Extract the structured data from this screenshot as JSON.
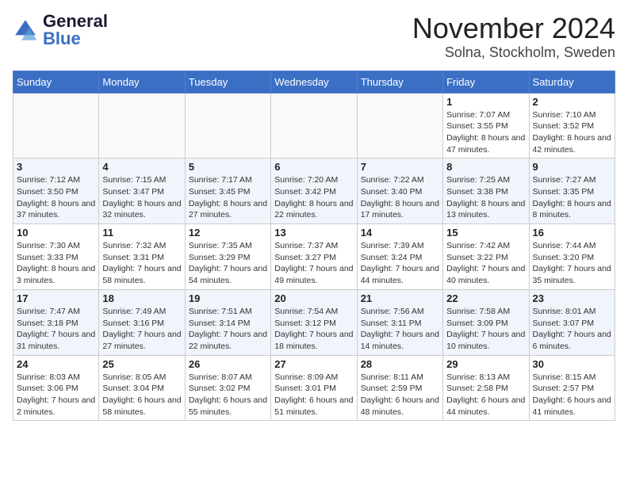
{
  "logo": {
    "text_general": "General",
    "text_blue": "Blue"
  },
  "title": "November 2024",
  "location": "Solna, Stockholm, Sweden",
  "days_of_week": [
    "Sunday",
    "Monday",
    "Tuesday",
    "Wednesday",
    "Thursday",
    "Friday",
    "Saturday"
  ],
  "weeks": [
    [
      {
        "day": "",
        "detail": ""
      },
      {
        "day": "",
        "detail": ""
      },
      {
        "day": "",
        "detail": ""
      },
      {
        "day": "",
        "detail": ""
      },
      {
        "day": "",
        "detail": ""
      },
      {
        "day": "1",
        "detail": "Sunrise: 7:07 AM\nSunset: 3:55 PM\nDaylight: 8 hours and 47 minutes."
      },
      {
        "day": "2",
        "detail": "Sunrise: 7:10 AM\nSunset: 3:52 PM\nDaylight: 8 hours and 42 minutes."
      }
    ],
    [
      {
        "day": "3",
        "detail": "Sunrise: 7:12 AM\nSunset: 3:50 PM\nDaylight: 8 hours and 37 minutes."
      },
      {
        "day": "4",
        "detail": "Sunrise: 7:15 AM\nSunset: 3:47 PM\nDaylight: 8 hours and 32 minutes."
      },
      {
        "day": "5",
        "detail": "Sunrise: 7:17 AM\nSunset: 3:45 PM\nDaylight: 8 hours and 27 minutes."
      },
      {
        "day": "6",
        "detail": "Sunrise: 7:20 AM\nSunset: 3:42 PM\nDaylight: 8 hours and 22 minutes."
      },
      {
        "day": "7",
        "detail": "Sunrise: 7:22 AM\nSunset: 3:40 PM\nDaylight: 8 hours and 17 minutes."
      },
      {
        "day": "8",
        "detail": "Sunrise: 7:25 AM\nSunset: 3:38 PM\nDaylight: 8 hours and 13 minutes."
      },
      {
        "day": "9",
        "detail": "Sunrise: 7:27 AM\nSunset: 3:35 PM\nDaylight: 8 hours and 8 minutes."
      }
    ],
    [
      {
        "day": "10",
        "detail": "Sunrise: 7:30 AM\nSunset: 3:33 PM\nDaylight: 8 hours and 3 minutes."
      },
      {
        "day": "11",
        "detail": "Sunrise: 7:32 AM\nSunset: 3:31 PM\nDaylight: 7 hours and 58 minutes."
      },
      {
        "day": "12",
        "detail": "Sunrise: 7:35 AM\nSunset: 3:29 PM\nDaylight: 7 hours and 54 minutes."
      },
      {
        "day": "13",
        "detail": "Sunrise: 7:37 AM\nSunset: 3:27 PM\nDaylight: 7 hours and 49 minutes."
      },
      {
        "day": "14",
        "detail": "Sunrise: 7:39 AM\nSunset: 3:24 PM\nDaylight: 7 hours and 44 minutes."
      },
      {
        "day": "15",
        "detail": "Sunrise: 7:42 AM\nSunset: 3:22 PM\nDaylight: 7 hours and 40 minutes."
      },
      {
        "day": "16",
        "detail": "Sunrise: 7:44 AM\nSunset: 3:20 PM\nDaylight: 7 hours and 35 minutes."
      }
    ],
    [
      {
        "day": "17",
        "detail": "Sunrise: 7:47 AM\nSunset: 3:18 PM\nDaylight: 7 hours and 31 minutes."
      },
      {
        "day": "18",
        "detail": "Sunrise: 7:49 AM\nSunset: 3:16 PM\nDaylight: 7 hours and 27 minutes."
      },
      {
        "day": "19",
        "detail": "Sunrise: 7:51 AM\nSunset: 3:14 PM\nDaylight: 7 hours and 22 minutes."
      },
      {
        "day": "20",
        "detail": "Sunrise: 7:54 AM\nSunset: 3:12 PM\nDaylight: 7 hours and 18 minutes."
      },
      {
        "day": "21",
        "detail": "Sunrise: 7:56 AM\nSunset: 3:11 PM\nDaylight: 7 hours and 14 minutes."
      },
      {
        "day": "22",
        "detail": "Sunrise: 7:58 AM\nSunset: 3:09 PM\nDaylight: 7 hours and 10 minutes."
      },
      {
        "day": "23",
        "detail": "Sunrise: 8:01 AM\nSunset: 3:07 PM\nDaylight: 7 hours and 6 minutes."
      }
    ],
    [
      {
        "day": "24",
        "detail": "Sunrise: 8:03 AM\nSunset: 3:06 PM\nDaylight: 7 hours and 2 minutes."
      },
      {
        "day": "25",
        "detail": "Sunrise: 8:05 AM\nSunset: 3:04 PM\nDaylight: 6 hours and 58 minutes."
      },
      {
        "day": "26",
        "detail": "Sunrise: 8:07 AM\nSunset: 3:02 PM\nDaylight: 6 hours and 55 minutes."
      },
      {
        "day": "27",
        "detail": "Sunrise: 8:09 AM\nSunset: 3:01 PM\nDaylight: 6 hours and 51 minutes."
      },
      {
        "day": "28",
        "detail": "Sunrise: 8:11 AM\nSunset: 2:59 PM\nDaylight: 6 hours and 48 minutes."
      },
      {
        "day": "29",
        "detail": "Sunrise: 8:13 AM\nSunset: 2:58 PM\nDaylight: 6 hours and 44 minutes."
      },
      {
        "day": "30",
        "detail": "Sunrise: 8:15 AM\nSunset: 2:57 PM\nDaylight: 6 hours and 41 minutes."
      }
    ]
  ]
}
